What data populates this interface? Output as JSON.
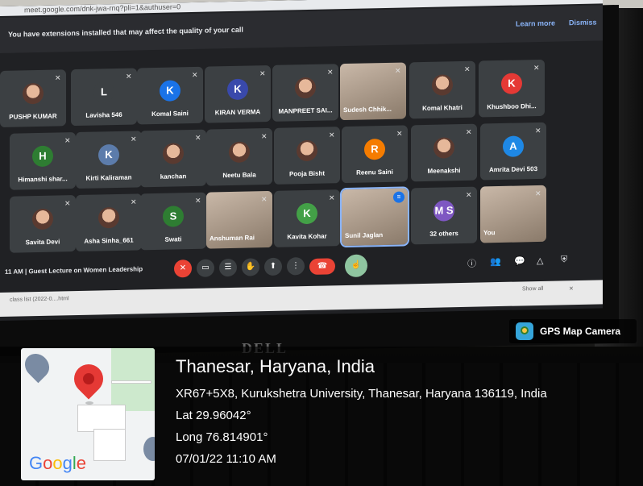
{
  "browser": {
    "url": "meet.google.com/dnk-jwa-rnq?pli=1&authuser=0"
  },
  "meet": {
    "extension_banner": "You have extensions installed that may affect the quality of your call",
    "learn_more": "Learn more",
    "dismiss": "Dismiss",
    "participants": [
      {
        "name": "PUSHP KUMAR",
        "initial": "",
        "color": "",
        "photo": true
      },
      {
        "name": "Lavisha 546",
        "initial": "L",
        "color": "#3c4043",
        "photo": false
      },
      {
        "name": "Komal Saini",
        "initial": "K",
        "color": "#1a73e8",
        "photo": false
      },
      {
        "name": "KIRAN VERMA",
        "initial": "K",
        "color": "#3949ab",
        "photo": false
      },
      {
        "name": "MANPREET SAI...",
        "initial": "",
        "color": "",
        "photo": true
      },
      {
        "name": "Sudesh Chhik...",
        "initial": "",
        "color": "",
        "photo": true,
        "video": true
      },
      {
        "name": "Komal Khatri",
        "initial": "",
        "color": "",
        "photo": true
      },
      {
        "name": "Khushboo Dhi...",
        "initial": "K",
        "color": "#e53935",
        "photo": false
      },
      {
        "name": "Himanshi shar...",
        "initial": "H",
        "color": "#2e7d32",
        "photo": false
      },
      {
        "name": "Kirti Kaliraman",
        "initial": "K",
        "color": "#5c7cab",
        "photo": false
      },
      {
        "name": "kanchan",
        "initial": "",
        "color": "",
        "photo": true
      },
      {
        "name": "Neetu Bala",
        "initial": "",
        "color": "",
        "photo": true
      },
      {
        "name": "Pooja Bisht",
        "initial": "",
        "color": "",
        "photo": true
      },
      {
        "name": "Reenu Saini",
        "initial": "R",
        "color": "#f57c00",
        "photo": false
      },
      {
        "name": "Meenakshi",
        "initial": "",
        "color": "",
        "photo": true
      },
      {
        "name": "Amrita Devi 503",
        "initial": "A",
        "color": "#1e88e5",
        "photo": false
      },
      {
        "name": "Savita Devi",
        "initial": "",
        "color": "",
        "photo": true
      },
      {
        "name": "Asha Sinha_661",
        "initial": "",
        "color": "",
        "photo": true
      },
      {
        "name": "Swati",
        "initial": "S",
        "color": "#2e7d32",
        "photo": false
      },
      {
        "name": "Anshuman Rai",
        "initial": "",
        "color": "",
        "photo": true,
        "video": true
      },
      {
        "name": "Kavita Kohar",
        "initial": "K",
        "color": "#43a047",
        "photo": false
      },
      {
        "name": "Sunil Jaglan",
        "initial": "",
        "color": "",
        "photo": true,
        "video": true,
        "speaking": true
      },
      {
        "name": "32 others",
        "initial": "M S",
        "color": "#7e57c2",
        "photo": false
      },
      {
        "name": "You",
        "initial": "",
        "color": "",
        "photo": true,
        "video": true
      }
    ],
    "meeting_info": "11 AM | Guest Lecture on Women Leadership",
    "others_count": "32 others"
  },
  "taskbar": {
    "download_file": "class list (2022-0....html",
    "show_all": "Show all"
  },
  "gps": {
    "badge": "GPS Map Camera",
    "place": "Thanesar, Haryana, India",
    "address": "XR67+5X8, Kurukshetra University, Thanesar, Haryana 136119, India",
    "lat": "Lat 29.96042°",
    "long": "Long 76.814901°",
    "datetime": "07/01/22 11:10 AM",
    "map_brand": "Google"
  },
  "laptop": {
    "brand": "DELL"
  }
}
